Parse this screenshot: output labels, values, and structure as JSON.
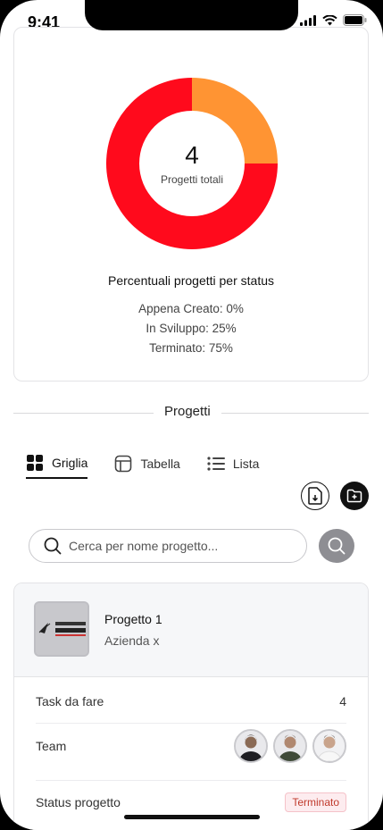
{
  "status_bar": {
    "time": "9:41"
  },
  "chart_data": {
    "type": "pie",
    "categories": [
      "Appena Creato",
      "In Sviluppo",
      "Terminato"
    ],
    "values": [
      0,
      25,
      75
    ],
    "colors": [
      "#9e9e9e",
      "#ff9433",
      "#ff0a1c"
    ],
    "title": "Percentuali progetti per status",
    "center_value": "4",
    "center_label": "Progetti totali",
    "legend": [
      "Appena Creato: 0%",
      "In Sviluppo: 25%",
      "Terminato: 75%"
    ]
  },
  "section": {
    "title": "Progetti"
  },
  "tabs": [
    {
      "label": "Griglia",
      "icon": "grid-icon",
      "active": true
    },
    {
      "label": "Tabella",
      "icon": "table-icon",
      "active": false
    },
    {
      "label": "Lista",
      "icon": "list-icon",
      "active": false
    }
  ],
  "search": {
    "placeholder": "Cerca per nome progetto..."
  },
  "project": {
    "name": "Progetto 1",
    "company": "Azienda x",
    "tasks_label": "Task da fare",
    "tasks_value": "4",
    "team_label": "Team",
    "status_label": "Status progetto",
    "status_value": "Terminato"
  },
  "colors": {
    "accent": "#ff0a1c",
    "secondary": "#ff9433",
    "badge_text": "#c0392b"
  }
}
